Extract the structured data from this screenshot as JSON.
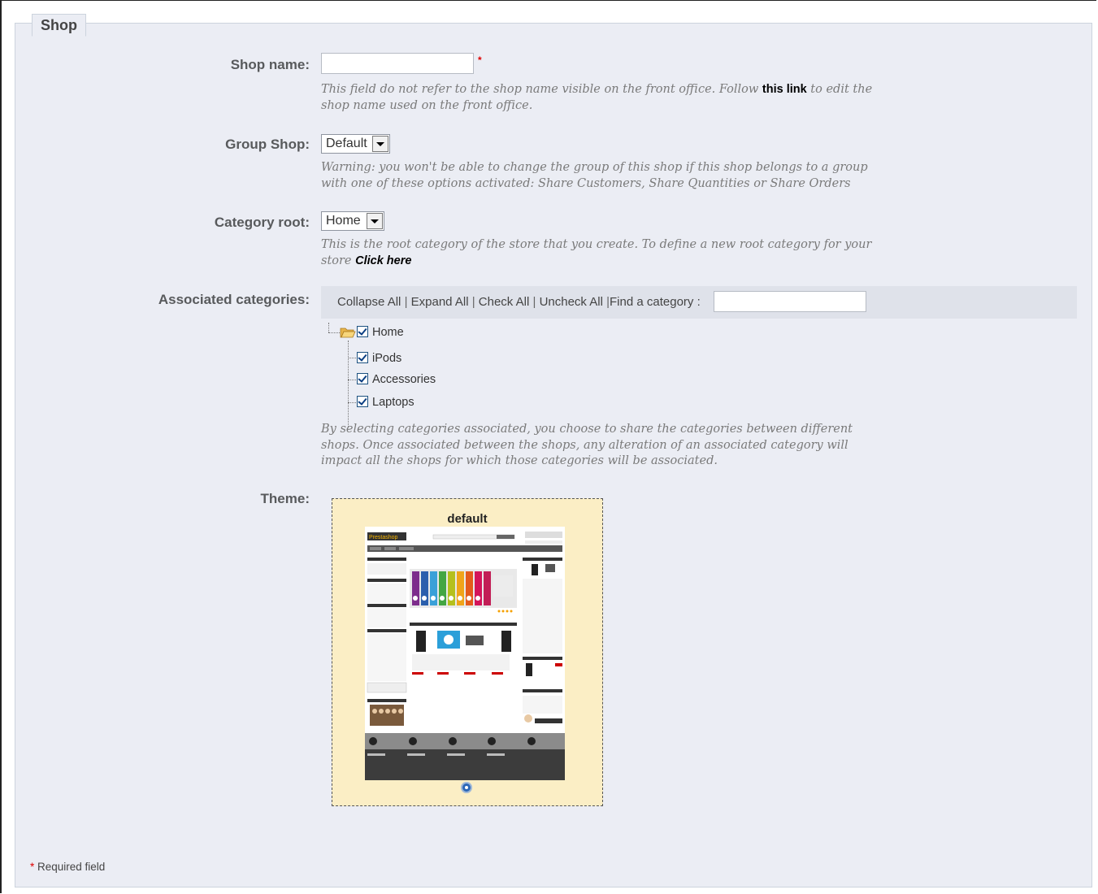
{
  "legend": "Shop",
  "shop_name": {
    "label": "Shop name:",
    "value": "",
    "required_mark": "*",
    "help_before": "This field do not refer to the shop name visible on the front office. Follow ",
    "help_link": "this link",
    "help_after": " to edit the shop name used on the front office."
  },
  "group_shop": {
    "label": "Group Shop:",
    "selected": "Default",
    "help": "Warning: you won't be able to change the group of this shop if this shop belongs to a group with one of these options activated: Share Customers, Share Quantities or Share Orders"
  },
  "category_root": {
    "label": "Category root:",
    "selected": "Home",
    "help_before": "This is the root category of the store that you create. To define a new root category for your store ",
    "help_link": "Click here"
  },
  "associated_categories": {
    "label": "Associated categories:",
    "toolbar": {
      "collapse_all": "Collapse All",
      "expand_all": "Expand All",
      "check_all": "Check All",
      "uncheck_all": "Uncheck All",
      "find_label": "Find a category :",
      "find_value": ""
    },
    "tree": {
      "root": "Home",
      "children": [
        "iPods",
        "Accessories",
        "Laptops"
      ]
    },
    "help": "By selecting categories associated, you choose to share the categories between different shops. Once associated between the shops, any alteration of an associated category will impact all the shops for which those categories will be associated."
  },
  "theme": {
    "label": "Theme:",
    "name": "default",
    "preview_logo": "Prestashop"
  },
  "required_note": {
    "star": "*",
    "text": " Required field"
  }
}
